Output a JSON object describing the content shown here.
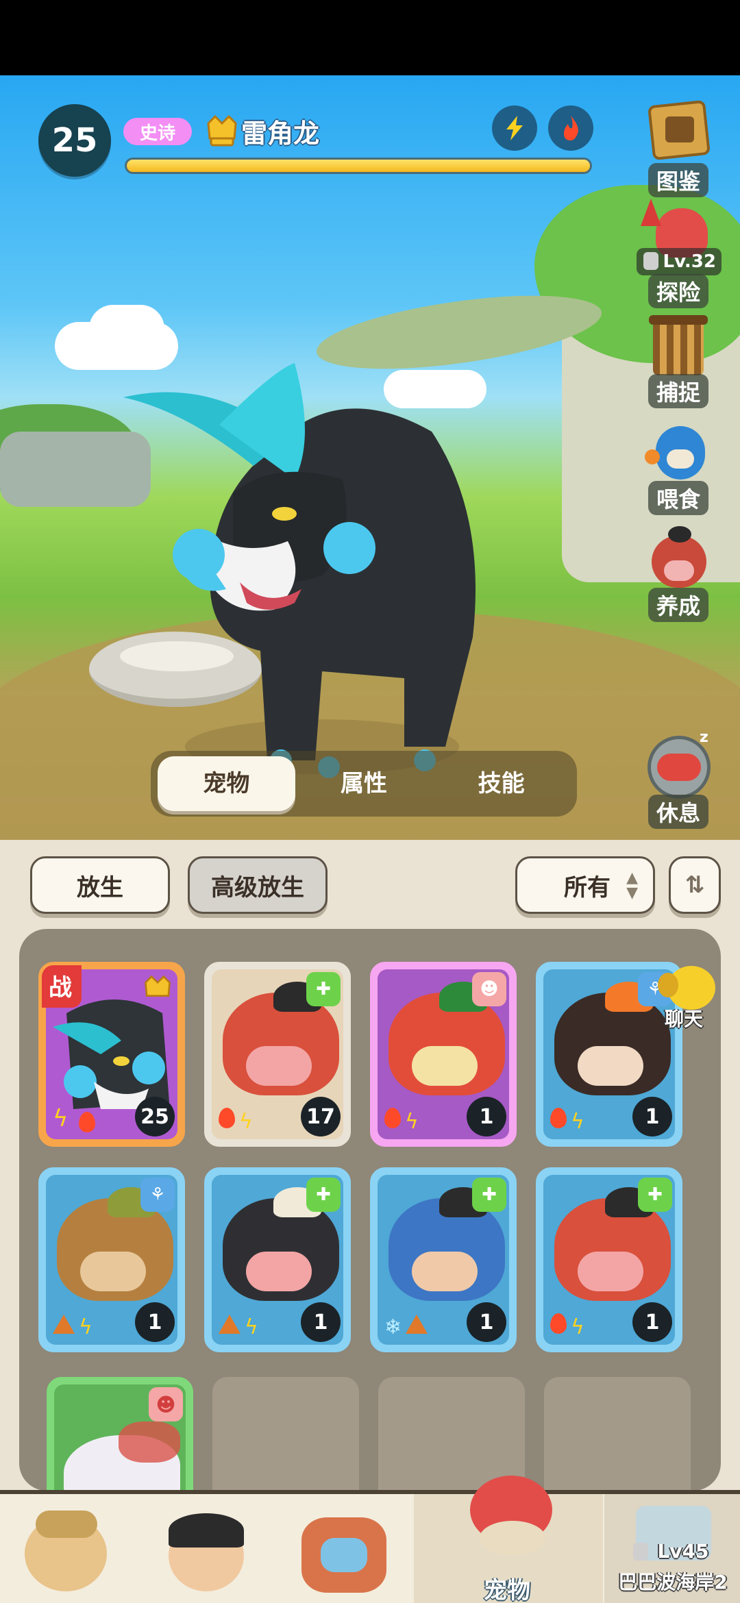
{
  "pet": {
    "level": "25",
    "rarity": "史诗",
    "name": "雷角龙",
    "exp_fraction": 1.0,
    "elements": [
      "lightning-icon",
      "fire-icon"
    ]
  },
  "side_menu": {
    "collection": "图鉴",
    "explore": "探险",
    "explore_lock": "Lv.32",
    "capture": "捕捉",
    "feed": "喂食",
    "cultivate": "养成",
    "rest": "休息"
  },
  "tabs": [
    "宠物",
    "属性",
    "技能"
  ],
  "active_tab": 0,
  "actions": {
    "release": "放生",
    "advanced_release": "高级放生",
    "filter": "所有"
  },
  "chat_label": "聊天",
  "pet_list": [
    {
      "level": "17",
      "frame": "#e8e3d6",
      "bg": "#e7d5b9",
      "creature": "boar-red",
      "corner": "heal-icon",
      "corner_color": "#6dd24a",
      "elements": [
        "fire",
        "lightning"
      ]
    },
    {
      "level": "1",
      "frame": "#f7a6f1",
      "bg": "#a65ac5",
      "creature": "dragon-red",
      "corner": "beast-icon",
      "corner_color": "#f5a7a7",
      "elements": [
        "fire",
        "lightning"
      ]
    },
    {
      "level": "1",
      "frame": "#8ad3f4",
      "bg": "#4fa8d6",
      "creature": "beaver",
      "corner": "wind-icon",
      "corner_color": "#5aa8e6",
      "elements": [
        "fire",
        "lightning"
      ]
    },
    {
      "level": "1",
      "frame": "#8ad3f4",
      "bg": "#4fa8d6",
      "creature": "monkey",
      "corner": "wind-icon",
      "corner_color": "#5aa8e6",
      "elements": [
        "earth",
        "lightning"
      ]
    },
    {
      "level": "1",
      "frame": "#8ad3f4",
      "bg": "#4fa8d6",
      "creature": "boar-dark",
      "corner": "heal-icon",
      "corner_color": "#6dd24a",
      "elements": [
        "earth",
        "lightning"
      ]
    },
    {
      "level": "1",
      "frame": "#8ad3f4",
      "bg": "#4fa8d6",
      "creature": "boar-blue",
      "corner": "heal-icon",
      "corner_color": "#6dd24a",
      "elements": [
        "ice",
        "earth"
      ]
    },
    {
      "level": "1",
      "frame": "#8ad3f4",
      "bg": "#4fa8d6",
      "creature": "boar-red",
      "corner": "heal-icon",
      "corner_color": "#6dd24a",
      "elements": [
        "fire",
        "lightning"
      ]
    }
  ],
  "featured_card": {
    "level": "25",
    "badge": "战",
    "creature": "triceratops-dark"
  },
  "bottom_nav": {
    "pets": "宠物",
    "locked_area": "巴巴波海岸2",
    "locked_level": "Lv45"
  },
  "colors": {
    "rarity": "#f28ef4",
    "exp_bar": "#f4b81f",
    "accent": "#17424f"
  }
}
